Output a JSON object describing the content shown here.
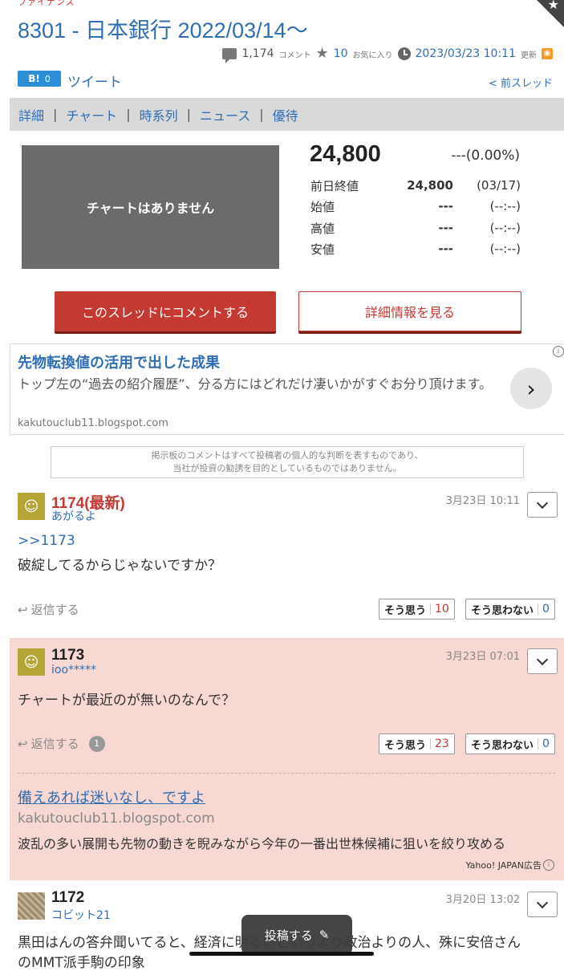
{
  "brand": "ファイナンス",
  "page_title": "8301 - 日本銀行 2022/03/14〜",
  "meta": {
    "comments": "1,174",
    "comments_unit": "コメント",
    "favorites": "10",
    "favorites_unit": "お気に入り",
    "updated": "2023/03/23 10:11",
    "updated_unit": "更新"
  },
  "share": {
    "hatena_label": "B!",
    "hatena_count": "0",
    "tweet": "ツイート",
    "prev_thread": "< 前スレッド"
  },
  "tabs": [
    "詳細",
    "チャート",
    "時系列",
    "ニュース",
    "優待"
  ],
  "quote": {
    "chart_placeholder": "チャートはありません",
    "price": "24,800",
    "change": "---(0.00%)",
    "rows": [
      {
        "label": "前日終値",
        "value": "24,800",
        "when": "(03/17)"
      },
      {
        "label": "始値",
        "value": "---",
        "when": "(--:--)"
      },
      {
        "label": "高値",
        "value": "---",
        "when": "(--:--)"
      },
      {
        "label": "安値",
        "value": "---",
        "when": "(--:--)"
      }
    ]
  },
  "actions": {
    "comment": "このスレッドにコメントする",
    "details": "詳細情報を見る"
  },
  "ad1": {
    "title": "先物転換値の活用で出した成果",
    "body": "トップ左の“過去の紹介履歴”、分る方にはどれだけ凄いかがすぐお分り頂けます。",
    "url": "kakutouclub11.blogspot.com"
  },
  "disclaimer": {
    "line1": "掲示板のコメントはすべて投稿者の個人的な判断を表すものであり、",
    "line2": "当社が投資の勧誘を目的としているものではありません。"
  },
  "comments": [
    {
      "num": "1174",
      "latest": "(最新)",
      "user": "あがるよ",
      "date": "3月23日 10:11",
      "reply_to": ">>1173",
      "text": "破綻してるからじゃないですか？",
      "reply_label": "返信する",
      "agree_label": "そう思う",
      "agree": "10",
      "disagree_label": "そう思わない",
      "disagree": "0"
    },
    {
      "num": "1173",
      "user": "ioo*****",
      "date": "3月23日 07:01",
      "text": "チャートが最近のが無いのなんで？",
      "reply_label": "返信する",
      "reply_count": "1",
      "agree_label": "そう思う",
      "agree": "23",
      "disagree_label": "そう思わない",
      "disagree": "0"
    },
    {
      "num": "1172",
      "user": "コビット21",
      "date": "3月20日 13:02",
      "text_line1": "黒田はんの答弁聞いてると、経済に明るいというより政治よりの人、殊に安倍さん",
      "text_line2": "のMMT派手駒の印象"
    }
  ],
  "ad2": {
    "title": "備えあれば迷いなし、ですよ",
    "url": "kakutouclub11.blogspot.com",
    "body": "波乱の多い展開も先物の動きを睨みながら今年の一番出世株候補に狙いを絞り攻める",
    "label": "Yahoo! JAPAN広告"
  },
  "post_button": "投稿する"
}
